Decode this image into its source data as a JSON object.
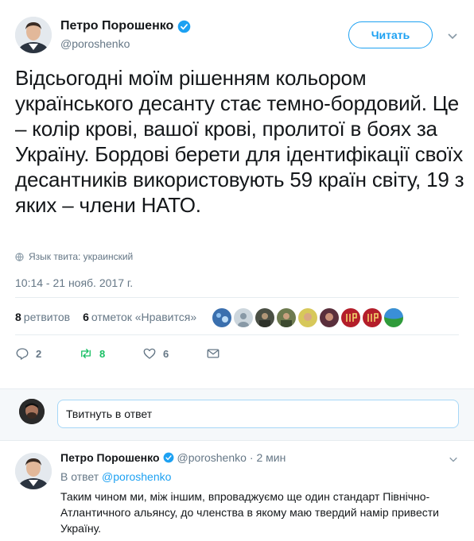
{
  "tweet": {
    "author_name": "Петро Порошенко",
    "author_handle": "@poroshenko",
    "follow_label": "Читать",
    "text": "Відсьогодні моїм рішенням кольором українського десанту стає темно-бордовий. Це – колір крові, вашої крові, пролитої в боях за Україну. Бордові берети для ідентифікації своїх десантників використовують 59 країн світу, 19 з яких – члени НАТО.",
    "language_label": "Язык твита: украинский",
    "timestamp": "10:14 - 21 нояб. 2017 г."
  },
  "stats": {
    "retweets_count": "8",
    "retweets_label": "ретвитов",
    "likes_count": "6",
    "likes_label": "отметок «Нравится»",
    "liker_avatars": [
      "avatar-1",
      "avatar-2",
      "avatar-3",
      "avatar-4",
      "avatar-5",
      "avatar-6",
      "avatar-7",
      "avatar-8",
      "avatar-9"
    ]
  },
  "actions": {
    "reply_count": "2",
    "retweet_count": "8",
    "like_count": "6"
  },
  "reply_box": {
    "placeholder": "Твитнуть в ответ"
  },
  "reply_tweet": {
    "author_name": "Петро Порошенко",
    "author_handle": "@poroshenko",
    "time": "· 2 мин",
    "in_reply_prefix": "В ответ",
    "in_reply_handle": "@poroshenko",
    "text": "Таким чином ми, між іншим, впроваджуємо ще один стандарт Північно-Атлантичного альянсу, до членства в якому маю твердий намір привести Україну."
  },
  "colors": {
    "accent": "#1da1f2",
    "retweet": "#17bf63",
    "secondary_text": "#657786"
  },
  "icons": [
    "verified-icon",
    "chevron-down-icon",
    "globe-icon",
    "reply-icon",
    "retweet-icon",
    "heart-icon",
    "mail-icon"
  ]
}
